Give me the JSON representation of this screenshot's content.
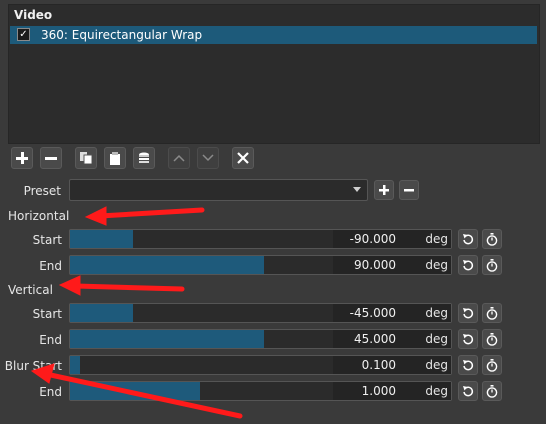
{
  "panel": {
    "title": "Video"
  },
  "filters": [
    {
      "label": "360: Equirectangular Wrap",
      "checked": "✓"
    }
  ],
  "toolbar": {
    "icons": [
      "add-icon",
      "remove-icon",
      "copy-icon",
      "paste-icon",
      "save-preset-icon",
      "move-up-icon",
      "move-down-icon",
      "close-icon"
    ]
  },
  "preset": {
    "label": "Preset",
    "value": ""
  },
  "sections": {
    "horizontal": "Horizontal",
    "vertical": "Vertical"
  },
  "params": {
    "h_start": {
      "label": "Start",
      "value": "-90.000",
      "unit": "deg",
      "fill": 0.165
    },
    "h_end": {
      "label": "End",
      "value": "90.000",
      "unit": "deg",
      "fill": 0.51
    },
    "v_start": {
      "label": "Start",
      "value": "-45.000",
      "unit": "deg",
      "fill": 0.165
    },
    "v_end": {
      "label": "End",
      "value": "45.000",
      "unit": "deg",
      "fill": 0.51
    },
    "b_start": {
      "label": "Blur Start",
      "value": "0.100",
      "unit": "deg",
      "fill": 0.025
    },
    "b_end": {
      "label": "End",
      "value": "1.000",
      "unit": "deg",
      "fill": 0.34
    }
  },
  "annotation_color": "#ff1a1a",
  "accent": "#1e5a7b"
}
